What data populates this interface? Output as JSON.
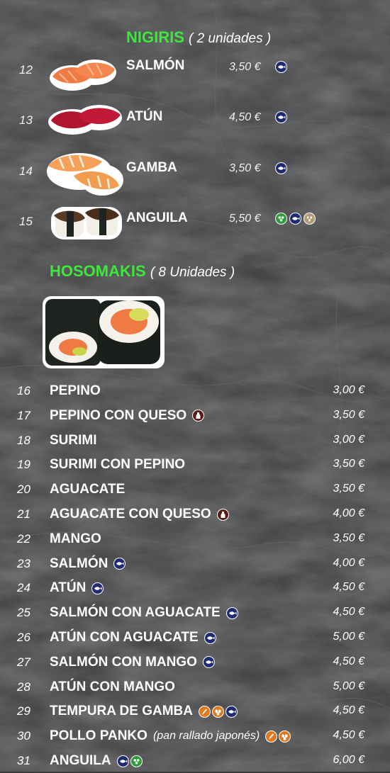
{
  "nigiris": {
    "title": "NIGIRIS",
    "qty": "( 2 unidades )",
    "items": [
      {
        "num": "12",
        "name": "SALMÓN",
        "price": "3,50 €",
        "icons": [
          "fish"
        ]
      },
      {
        "num": "13",
        "name": "ATÚN",
        "price": "4,50 €",
        "icons": [
          "fish"
        ]
      },
      {
        "num": "14",
        "name": "GAMBA",
        "price": "3,50 €",
        "icons": [
          "fish"
        ]
      },
      {
        "num": "15",
        "name": "ANGUILA",
        "price": "5,50 €",
        "icons": [
          "veg",
          "fish",
          "sesame"
        ]
      }
    ]
  },
  "hosomakis": {
    "title": "HOSOMAKIS",
    "qty": "( 8 Unidades )",
    "items": [
      {
        "num": "16",
        "name": "PEPINO",
        "note": "",
        "price": "3,00 €",
        "icons": []
      },
      {
        "num": "17",
        "name": "PEPINO CON QUESO",
        "note": "",
        "price": "3,50 €",
        "icons": [
          "milk"
        ]
      },
      {
        "num": "18",
        "name": "SURIMI",
        "note": "",
        "price": "3,00 €",
        "icons": []
      },
      {
        "num": "19",
        "name": "SURIMI CON PEPINO",
        "note": "",
        "price": "3,50 €",
        "icons": []
      },
      {
        "num": "20",
        "name": "AGUACATE",
        "note": "",
        "price": "3,50 €",
        "icons": []
      },
      {
        "num": "21",
        "name": "AGUACATE CON QUESO",
        "note": "",
        "price": "4,00 €",
        "icons": [
          "milk"
        ]
      },
      {
        "num": "22",
        "name": "MANGO",
        "note": "",
        "price": "3,50 €",
        "icons": []
      },
      {
        "num": "23",
        "name": "SALMÓN",
        "note": "",
        "price": "4,00 €",
        "icons": [
          "fish"
        ]
      },
      {
        "num": "24",
        "name": "ATÚN",
        "note": "",
        "price": "4,50 €",
        "icons": [
          "fish"
        ]
      },
      {
        "num": "25",
        "name": "SALMÓN CON AGUACATE",
        "note": "",
        "price": "4,50 €",
        "icons": [
          "fish"
        ]
      },
      {
        "num": "26",
        "name": "ATÚN CON AGUACATE",
        "note": "",
        "price": "5,00 €",
        "icons": [
          "fish"
        ]
      },
      {
        "num": "27",
        "name": "SALMÓN CON MANGO",
        "note": "",
        "price": "4,50 €",
        "icons": [
          "fish"
        ]
      },
      {
        "num": "28",
        "name": "ATÚN CON MANGO",
        "note": "",
        "price": "5,00 €",
        "icons": []
      },
      {
        "num": "29",
        "name": "TEMPURA DE GAMBA",
        "note": "",
        "price": "4,50 €",
        "icons": [
          "gluten",
          "egg",
          "fish"
        ]
      },
      {
        "num": "30",
        "name": "POLLO PANKO",
        "note": "(pan rallado japonés)",
        "price": "4,50 €",
        "icons": [
          "gluten",
          "egg"
        ]
      },
      {
        "num": "31",
        "name": "ANGUILA",
        "note": "",
        "price": "6,00 €",
        "icons": [
          "fish",
          "veg"
        ]
      }
    ]
  },
  "colors": {
    "section_title": "#3ee83a",
    "fish_icon": "#1f2b6e",
    "veg_icon": "#2f9a3c",
    "sesame_icon": "#b29a73",
    "milk_icon": "#5a1c14",
    "gluten_icon": "#e0791d"
  }
}
